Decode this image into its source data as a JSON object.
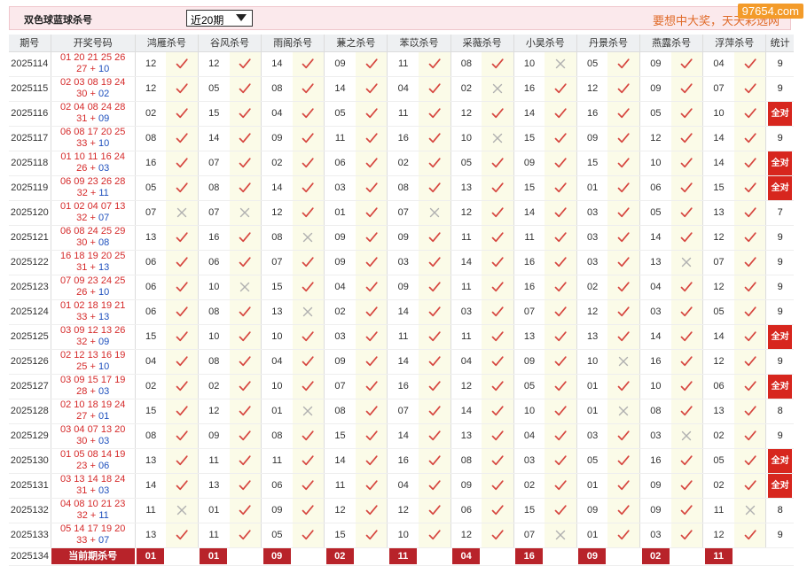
{
  "header": {
    "title": "双色球蓝球杀号",
    "period_select": "近20期",
    "slogan": "要想中大奖，天天彩选网",
    "site_logo": "97654.com"
  },
  "columns": [
    "期号",
    "开奖号码",
    "鸿雁杀号",
    "谷风杀号",
    "雨阁杀号",
    "蒹之杀号",
    "苯苡杀号",
    "采薇杀号",
    "小昊杀号",
    "丹景杀号",
    "燕露杀号",
    "浮萍杀号",
    "统计"
  ],
  "rows": [
    {
      "issue": "2025114",
      "l1": "01 20 21 25 26",
      "l2a": "27",
      "blue": "10",
      "k": [
        "12",
        "12",
        "14",
        "09",
        "11",
        "08",
        "10",
        "05",
        "09",
        "04"
      ],
      "m": [
        1,
        1,
        1,
        1,
        1,
        1,
        0,
        1,
        1,
        1
      ],
      "stat": "9"
    },
    {
      "issue": "2025115",
      "l1": "02 03 08 19 24",
      "l2a": "30",
      "blue": "02",
      "k": [
        "12",
        "05",
        "08",
        "14",
        "04",
        "02",
        "16",
        "12",
        "09",
        "07"
      ],
      "m": [
        1,
        1,
        1,
        1,
        1,
        0,
        1,
        1,
        1,
        1
      ],
      "stat": "9"
    },
    {
      "issue": "2025116",
      "l1": "02 04 08 24 28",
      "l2a": "31",
      "blue": "09",
      "k": [
        "02",
        "15",
        "04",
        "05",
        "11",
        "12",
        "14",
        "16",
        "05",
        "10"
      ],
      "m": [
        1,
        1,
        1,
        1,
        1,
        1,
        1,
        1,
        1,
        1
      ],
      "stat": "全对"
    },
    {
      "issue": "2025117",
      "l1": "06 08 17 20 25",
      "l2a": "33",
      "blue": "10",
      "k": [
        "08",
        "14",
        "09",
        "11",
        "16",
        "10",
        "15",
        "09",
        "12",
        "14"
      ],
      "m": [
        1,
        1,
        1,
        1,
        1,
        0,
        1,
        1,
        1,
        1
      ],
      "stat": "9"
    },
    {
      "issue": "2025118",
      "l1": "01 10 11 16 24",
      "l2a": "26",
      "blue": "03",
      "k": [
        "16",
        "07",
        "02",
        "06",
        "02",
        "05",
        "09",
        "15",
        "10",
        "14"
      ],
      "m": [
        1,
        1,
        1,
        1,
        1,
        1,
        1,
        1,
        1,
        1
      ],
      "stat": "全对"
    },
    {
      "issue": "2025119",
      "l1": "06 09 23 26 28",
      "l2a": "32",
      "blue": "11",
      "k": [
        "05",
        "08",
        "14",
        "03",
        "08",
        "13",
        "15",
        "01",
        "06",
        "15"
      ],
      "m": [
        1,
        1,
        1,
        1,
        1,
        1,
        1,
        1,
        1,
        1
      ],
      "stat": "全对"
    },
    {
      "issue": "2025120",
      "l1": "01 02 04 07 13",
      "l2a": "32",
      "blue": "07",
      "k": [
        "07",
        "07",
        "12",
        "01",
        "07",
        "12",
        "14",
        "03",
        "05",
        "13"
      ],
      "m": [
        0,
        0,
        1,
        1,
        0,
        1,
        1,
        1,
        1,
        1
      ],
      "stat": "7"
    },
    {
      "issue": "2025121",
      "l1": "06 08 24 25 29",
      "l2a": "30",
      "blue": "08",
      "k": [
        "13",
        "16",
        "08",
        "09",
        "09",
        "11",
        "11",
        "03",
        "14",
        "12"
      ],
      "m": [
        1,
        1,
        0,
        1,
        1,
        1,
        1,
        1,
        1,
        1
      ],
      "stat": "9"
    },
    {
      "issue": "2025122",
      "l1": "16 18 19 20 25",
      "l2a": "31",
      "blue": "13",
      "k": [
        "06",
        "06",
        "07",
        "09",
        "03",
        "14",
        "16",
        "03",
        "13",
        "07"
      ],
      "m": [
        1,
        1,
        1,
        1,
        1,
        1,
        1,
        1,
        0,
        1
      ],
      "stat": "9"
    },
    {
      "issue": "2025123",
      "l1": "07 09 23 24 25",
      "l2a": "26",
      "blue": "10",
      "k": [
        "06",
        "10",
        "15",
        "04",
        "09",
        "11",
        "16",
        "02",
        "04",
        "12"
      ],
      "m": [
        1,
        0,
        1,
        1,
        1,
        1,
        1,
        1,
        1,
        1
      ],
      "stat": "9"
    },
    {
      "issue": "2025124",
      "l1": "01 02 18 19 21",
      "l2a": "33",
      "blue": "13",
      "k": [
        "06",
        "08",
        "13",
        "02",
        "14",
        "03",
        "07",
        "12",
        "03",
        "05"
      ],
      "m": [
        1,
        1,
        0,
        1,
        1,
        1,
        1,
        1,
        1,
        1
      ],
      "stat": "9"
    },
    {
      "issue": "2025125",
      "l1": "03 09 12 13 26",
      "l2a": "32",
      "blue": "09",
      "k": [
        "15",
        "10",
        "10",
        "03",
        "11",
        "11",
        "13",
        "13",
        "14",
        "14"
      ],
      "m": [
        1,
        1,
        1,
        1,
        1,
        1,
        1,
        1,
        1,
        1
      ],
      "stat": "全对"
    },
    {
      "issue": "2025126",
      "l1": "02 12 13 16 19",
      "l2a": "25",
      "blue": "10",
      "k": [
        "04",
        "08",
        "04",
        "09",
        "14",
        "04",
        "09",
        "10",
        "16",
        "12"
      ],
      "m": [
        1,
        1,
        1,
        1,
        1,
        1,
        1,
        0,
        1,
        1
      ],
      "stat": "9"
    },
    {
      "issue": "2025127",
      "l1": "03 09 15 17 19",
      "l2a": "28",
      "blue": "03",
      "k": [
        "02",
        "02",
        "10",
        "07",
        "16",
        "12",
        "05",
        "01",
        "10",
        "06"
      ],
      "m": [
        1,
        1,
        1,
        1,
        1,
        1,
        1,
        1,
        1,
        1
      ],
      "stat": "全对"
    },
    {
      "issue": "2025128",
      "l1": "02 10 18 19 24",
      "l2a": "27",
      "blue": "01",
      "k": [
        "15",
        "12",
        "01",
        "08",
        "07",
        "14",
        "10",
        "01",
        "08",
        "13"
      ],
      "m": [
        1,
        1,
        0,
        1,
        1,
        1,
        1,
        0,
        1,
        1
      ],
      "stat": "8"
    },
    {
      "issue": "2025129",
      "l1": "03 04 07 13 20",
      "l2a": "30",
      "blue": "03",
      "k": [
        "08",
        "09",
        "08",
        "15",
        "14",
        "13",
        "04",
        "03",
        "03",
        "02"
      ],
      "m": [
        1,
        1,
        1,
        1,
        1,
        1,
        1,
        1,
        0,
        1
      ],
      "stat": "9"
    },
    {
      "issue": "2025130",
      "l1": "01 05 08 14 19",
      "l2a": "23",
      "blue": "06",
      "k": [
        "13",
        "11",
        "11",
        "14",
        "16",
        "08",
        "03",
        "05",
        "16",
        "05"
      ],
      "m": [
        1,
        1,
        1,
        1,
        1,
        1,
        1,
        1,
        1,
        1
      ],
      "stat": "全对"
    },
    {
      "issue": "2025131",
      "l1": "03 13 14 18 24",
      "l2a": "31",
      "blue": "03",
      "k": [
        "14",
        "13",
        "06",
        "11",
        "04",
        "09",
        "02",
        "01",
        "09",
        "02"
      ],
      "m": [
        1,
        1,
        1,
        1,
        1,
        1,
        1,
        1,
        1,
        1
      ],
      "stat": "全对"
    },
    {
      "issue": "2025132",
      "l1": "04 08 10 21 23",
      "l2a": "32",
      "blue": "11",
      "k": [
        "11",
        "01",
        "09",
        "12",
        "12",
        "06",
        "15",
        "09",
        "09",
        "11"
      ],
      "m": [
        0,
        1,
        1,
        1,
        1,
        1,
        1,
        1,
        1,
        0
      ],
      "stat": "8"
    },
    {
      "issue": "2025133",
      "l1": "05 14 17 19 20",
      "l2a": "33",
      "blue": "07",
      "k": [
        "13",
        "11",
        "05",
        "15",
        "10",
        "12",
        "07",
        "01",
        "03",
        "12"
      ],
      "m": [
        1,
        1,
        1,
        1,
        1,
        1,
        0,
        1,
        1,
        1
      ],
      "stat": "9"
    }
  ],
  "footer": {
    "issue": "2025134",
    "label": "当前期杀号",
    "kills": [
      "01",
      "01",
      "09",
      "02",
      "11",
      "04",
      "16",
      "09",
      "02",
      "11"
    ]
  },
  "colors": {
    "check": "#d6463f",
    "cross": "#b0b0b0",
    "badge": "#d7261e",
    "kill_box": "#b8232a",
    "winning": "#d52a2a",
    "blue_ball": "#1d4fbd"
  },
  "icons": {
    "correct": "check-icon",
    "wrong": "cross-icon"
  }
}
